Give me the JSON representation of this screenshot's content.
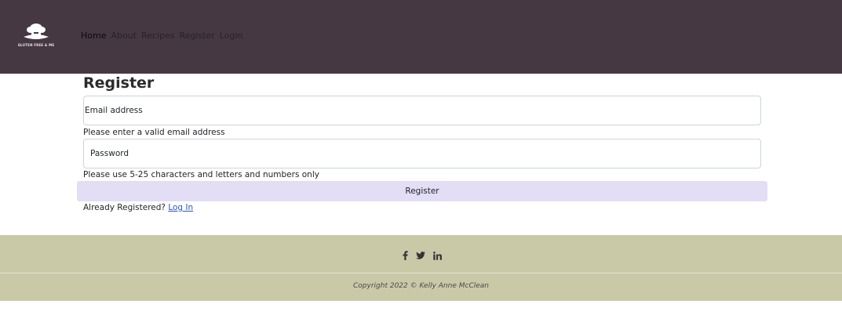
{
  "nav": {
    "logo_text": "GLUTEN FREE & ME",
    "links": [
      "Home",
      "About",
      "Recipes",
      "Register",
      "Login"
    ]
  },
  "form": {
    "title": "Register",
    "email_placeholder": "Email address",
    "email_help": "Please enter a valid email address",
    "password_placeholder": "Password",
    "password_help": "Please use 5-25 characters and letters and numbers only",
    "submit_label": "Register",
    "already_text": "Already Registered?",
    "login_link": "Log In"
  },
  "footer": {
    "social_icons": [
      "facebook-icon",
      "twitter-icon",
      "linkedin-icon"
    ],
    "copyright": "Copyright 2022 © Kelly Anne McClean"
  },
  "colors": {
    "navbar": "#463843",
    "button": "#e3ddf5",
    "footer": "#c9c9a8",
    "link": "#2b58c6"
  }
}
